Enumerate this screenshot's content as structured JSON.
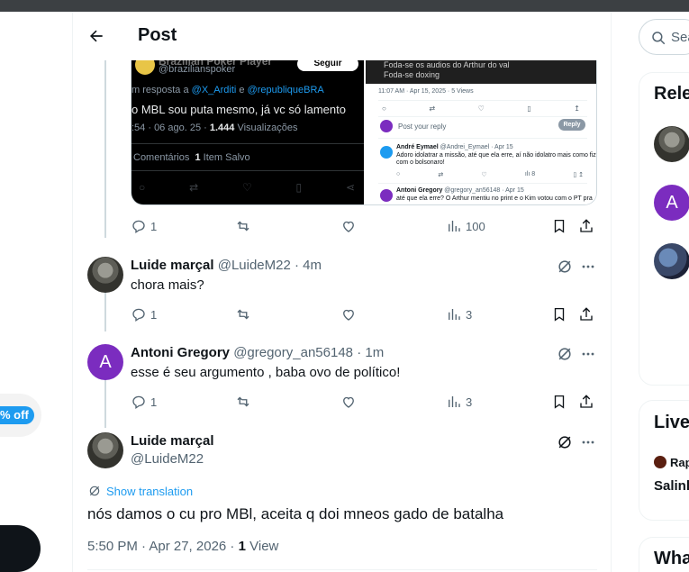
{
  "header": {
    "title": "Post"
  },
  "offer": {
    "badge": "% off"
  },
  "media": {
    "left": {
      "account_name": "Brazilian Poker Player",
      "account_handle": "@brazilianspoker",
      "follow_label": "Seguir",
      "reply_to_prefix": "m resposta a",
      "reply_to_user1": "@X_Arditi",
      "reply_to_sep": "e",
      "reply_to_user2": "@republiqueBRA",
      "tweet_text": "o MBL sou puta mesmo, já vc só lamento",
      "meta_time": ":54 · 06 ago. 25 ·",
      "meta_views": "1.444",
      "meta_views_label": "Visualizações",
      "comments_label": "Comentários",
      "saved_count": "1",
      "saved_label": "Item Salvo"
    },
    "right": {
      "line1": "Foda-se os audios do Arthur do val",
      "line2": "Foda-se doxing",
      "meta": "11:07 AM · Apr 15, 2025 · 5 Views",
      "reply_placeholder": "Post your reply",
      "reply_button": "Reply",
      "r1_name": "André Eymael",
      "r1_handle": "@Andrei_Eymael · Apr 15",
      "r1_text1": "Adoro idolatrar a missão, até que ela erre, aí não idolatro mais como fiz",
      "r1_text2": "com o bolsonaro!",
      "r1_views": "8",
      "r2_name": "Antoni Gregory",
      "r2_handle": "@gregory_an56148 · Apr 15",
      "r2_text": "até que ela erre? O Arthur mentiu no print e o Kim votou com o PT pra"
    }
  },
  "main_actions": {
    "replies": "1",
    "views": "100"
  },
  "replies": [
    {
      "name": "Luide marçal",
      "handle": "@LuideM22",
      "time": "· 4m",
      "text": "chora mais?",
      "replies": "1",
      "views": "3"
    },
    {
      "name": "Antoni Gregory",
      "handle": "@gregory_an56148",
      "time": "· 1m",
      "avatar_letter": "A",
      "text": "esse é seu argumento , baba ovo de político!",
      "replies": "1",
      "views": "3"
    }
  ],
  "focused": {
    "name": "Luide marçal",
    "handle": "@LuideM22",
    "translate_label": "Show translation",
    "text": "nós damos o cu pro MBl, aceita q doi mneos gado de batalha",
    "timestamp": "5:50 PM · Apr 27, 2026 ·",
    "views_count": "1",
    "views_label": "View"
  },
  "sidebar": {
    "search_placeholder": "Sea",
    "relevant_title": "Rele",
    "relevant_avatar_letter": "A",
    "live_title": "Live",
    "live_line1": "Rap",
    "live_line2": "Salinl",
    "whats_title": "Wha"
  },
  "colors": {
    "accent": "#1d9bf0",
    "avatar_purple": "#7b2cbf",
    "text_secondary": "#536471"
  }
}
